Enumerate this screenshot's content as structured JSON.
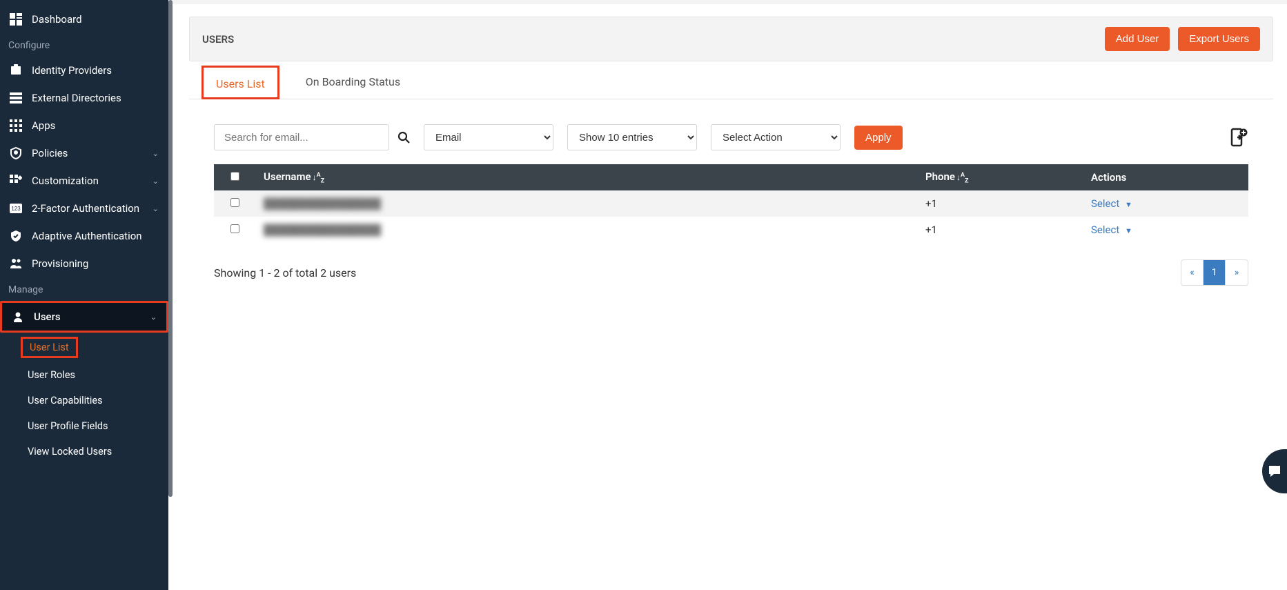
{
  "sidebar": {
    "top": [
      {
        "icon": "dashboard-icon",
        "label": "Dashboard"
      }
    ],
    "sections": [
      {
        "label": "Configure",
        "items": [
          {
            "icon": "idp-icon",
            "label": "Identity Providers",
            "chevron": false
          },
          {
            "icon": "ext-dir-icon",
            "label": "External Directories",
            "chevron": false
          },
          {
            "icon": "apps-icon",
            "label": "Apps",
            "chevron": false
          },
          {
            "icon": "policies-icon",
            "label": "Policies",
            "chevron": true
          },
          {
            "icon": "customization-icon",
            "label": "Customization",
            "chevron": true
          },
          {
            "icon": "twofa-icon",
            "label": "2-Factor Authentication",
            "chevron": true
          },
          {
            "icon": "adaptive-auth-icon",
            "label": "Adaptive Authentication",
            "chevron": false
          },
          {
            "icon": "provisioning-icon",
            "label": "Provisioning",
            "chevron": false
          }
        ]
      },
      {
        "label": "Manage",
        "items": [
          {
            "icon": "users-icon",
            "label": "Users",
            "chevron": true,
            "active": true,
            "subitems": [
              {
                "label": "User List",
                "highlight": true
              },
              {
                "label": "User Roles"
              },
              {
                "label": "User Capabilities"
              },
              {
                "label": "User Profile Fields"
              },
              {
                "label": "View Locked Users"
              }
            ]
          }
        ]
      }
    ]
  },
  "header": {
    "title": "USERS",
    "add_user": "Add User",
    "export_users": "Export Users"
  },
  "tabs": [
    {
      "label": "Users List",
      "active": true
    },
    {
      "label": "On Boarding Status",
      "active": false
    }
  ],
  "filters": {
    "search_placeholder": "Search for email...",
    "field_select": "Email",
    "entries_select": "Show 10 entries",
    "action_select": "Select Action",
    "apply_label": "Apply"
  },
  "table": {
    "columns": {
      "username": "Username",
      "phone": "Phone",
      "actions": "Actions"
    },
    "rows": [
      {
        "username": "████████████████",
        "phone": "+1",
        "action_label": "Select"
      },
      {
        "username": "████████████████",
        "phone": "+1",
        "action_label": "Select"
      }
    ],
    "showing_text": "Showing 1 - 2 of total 2 users"
  },
  "pagination": {
    "prev": "«",
    "current": "1",
    "next": "»"
  }
}
